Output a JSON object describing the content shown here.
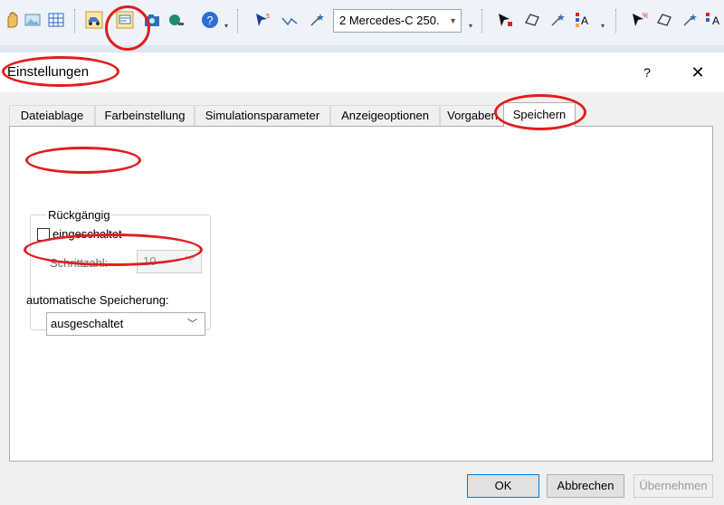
{
  "toolbar": {
    "vehicle_selector": "2  Mercedes-C 250.",
    "icons": [
      "hand-icon",
      "picture-icon",
      "grid-icon",
      "vehicle-icon",
      "settings-dialog-icon",
      "camera-icon",
      "camera-alt-icon",
      "help-icon",
      "cursor-icon",
      "polyline-icon",
      "magic-icon",
      "select-cursor-icon",
      "polygon-icon",
      "magic-alt-icon",
      "color-text-icon",
      "cursor-alt-icon",
      "polygon-alt-icon",
      "magic-alt2-icon",
      "color-text-alt-icon"
    ]
  },
  "dialog": {
    "title": "Einstellungen",
    "help_label": "?",
    "close_label": "✕",
    "tabs": [
      {
        "label": "Dateiablage"
      },
      {
        "label": "Farbeinstellung"
      },
      {
        "label": "Simulationsparameter"
      },
      {
        "label": "Anzeigeoptionen"
      },
      {
        "label": "Vorgaben"
      },
      {
        "label": "Speichern"
      }
    ],
    "active_tab": "Speichern",
    "undo_group": {
      "title": "Rückgängig",
      "enabled_label": "eingeschaltet",
      "enabled_checked": false,
      "steps_label": "Schrittzahl:",
      "steps_value": "10"
    },
    "autosave": {
      "label": "automatische Speicherung:",
      "value": "ausgeschaltet"
    },
    "buttons": {
      "ok": "OK",
      "cancel": "Abbrechen",
      "apply": "Übernehmen"
    }
  },
  "colors": {
    "annotation": "#e11d1d",
    "toolbar_bg": "#eef3fa",
    "dialog_bg": "#f0f0f0"
  }
}
